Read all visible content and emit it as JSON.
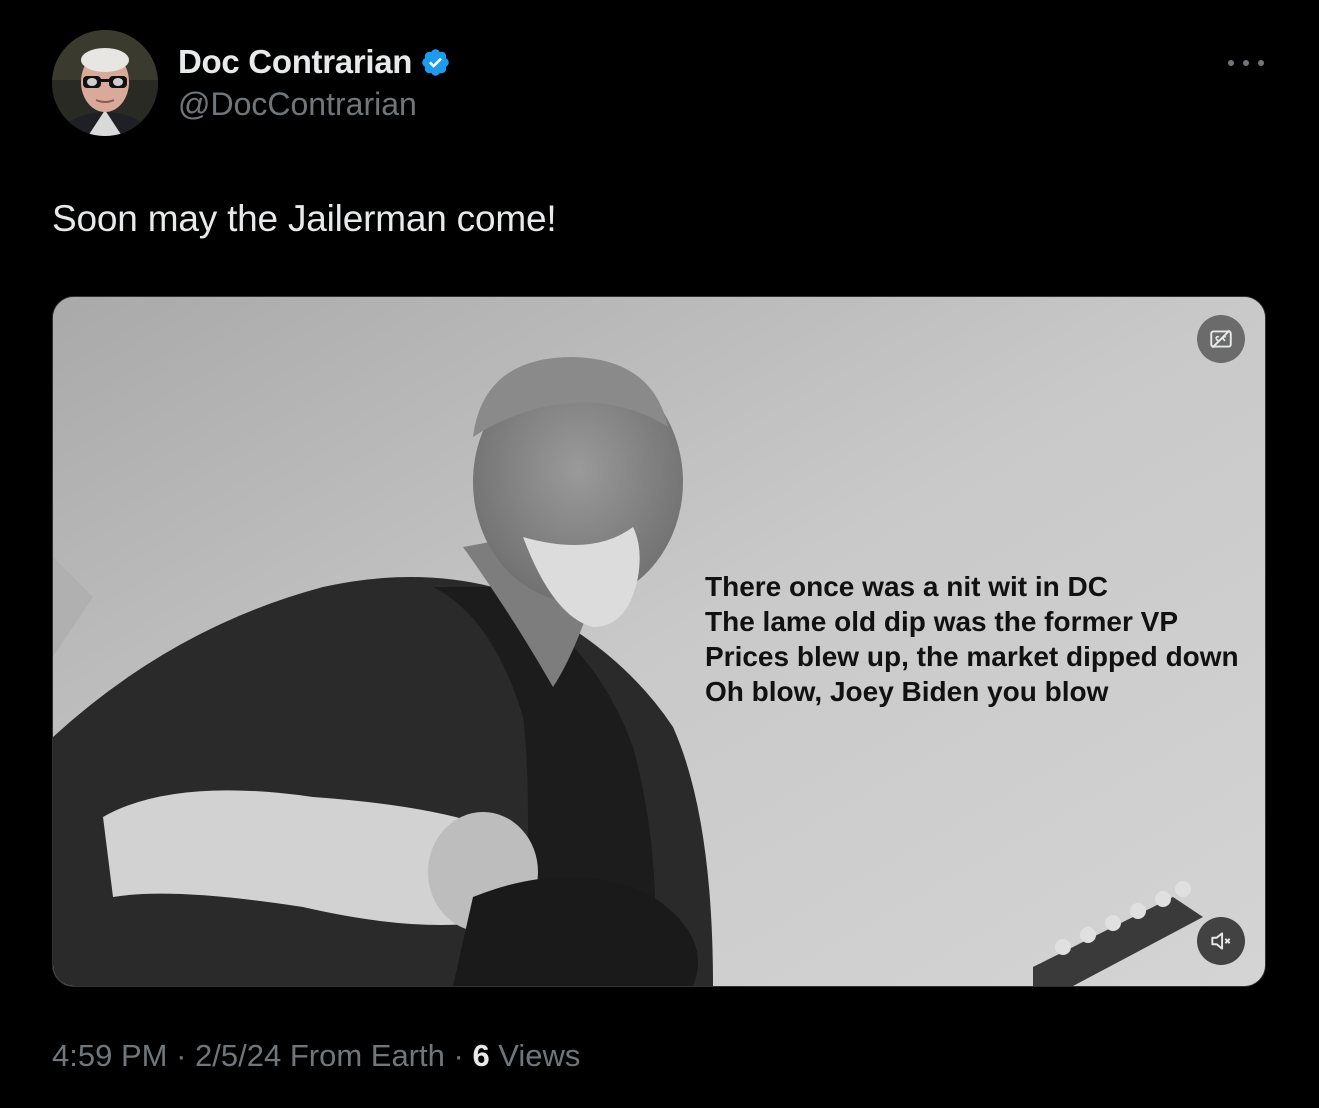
{
  "author": {
    "display_name": "Doc Contrarian",
    "handle": "@DocContrarian",
    "verified": true,
    "verified_color": "#1d9bf0"
  },
  "tweet": {
    "text": "Soon may the Jailerman come!"
  },
  "media": {
    "type": "video",
    "lyrics": [
      "There once was a nit wit in DC",
      "The lame old dip was the former VP",
      "Prices blew up, the market dipped down",
      "Oh blow, Joey Biden you blow"
    ],
    "captions_icon": "closed-captions-off-icon",
    "mute_icon": "muted-speaker-icon"
  },
  "meta": {
    "time": "4:59 PM",
    "separator": " · ",
    "date": "2/5/24",
    "source": " From Earth",
    "views_count": "6",
    "views_label": " Views"
  },
  "colors": {
    "background": "#000000",
    "primary_text": "#e7e9ea",
    "secondary_text": "#71767b"
  }
}
